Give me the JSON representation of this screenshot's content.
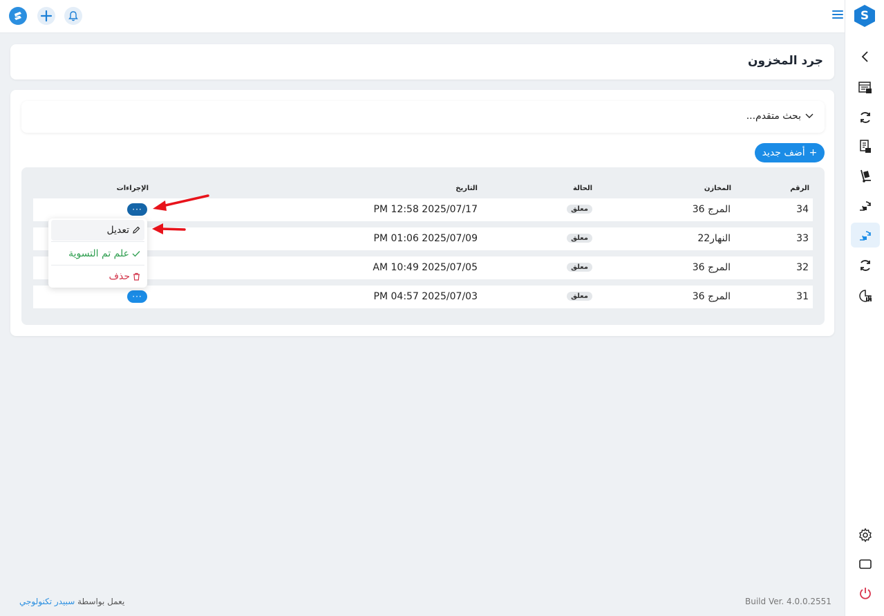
{
  "header": {
    "page_title": "جرد المخزون"
  },
  "search": {
    "label": "بحث متقدم..."
  },
  "toolbar": {
    "add_label": "أضف جديد"
  },
  "table": {
    "columns": {
      "number": "الرقم",
      "warehouse": "المخازن",
      "status": "الحالة",
      "date": "التاريخ",
      "actions": "الإجراءات"
    },
    "rows": [
      {
        "number": "34",
        "warehouse": "المرج 36",
        "status": "معلق",
        "date": "PM 12:58 2025/07/17"
      },
      {
        "number": "33",
        "warehouse": "النهار22",
        "status": "معلق",
        "date": "PM 01:06 2025/07/09"
      },
      {
        "number": "32",
        "warehouse": "المرج 36",
        "status": "معلق",
        "date": "AM 10:49 2025/07/05"
      },
      {
        "number": "31",
        "warehouse": "المرج 36",
        "status": "معلق",
        "date": "PM 04:57 2025/07/03"
      }
    ],
    "action_label": "···"
  },
  "dropdown": {
    "edit": "تعديل",
    "settle": "علم تم التسوية",
    "delete": "حذف"
  },
  "footer": {
    "powered_prefix": "يعمل بواسطة",
    "powered_brand": "سبيدر تكنولوجي",
    "build": "Build Ver. 4.0.0.2551"
  },
  "icons": {
    "logo": "spider-logo-icon",
    "add": "plus-icon",
    "notifications": "bell-icon",
    "menu": "hamburger-icon",
    "collapse": "chevron-left-icon",
    "settings": "gear-icon",
    "screen": "monitor-icon",
    "logout": "power-icon"
  },
  "colors": {
    "primary": "#1b8ce6",
    "success": "#2e9e4f",
    "danger": "#d2344a",
    "power": "#d9334d"
  }
}
